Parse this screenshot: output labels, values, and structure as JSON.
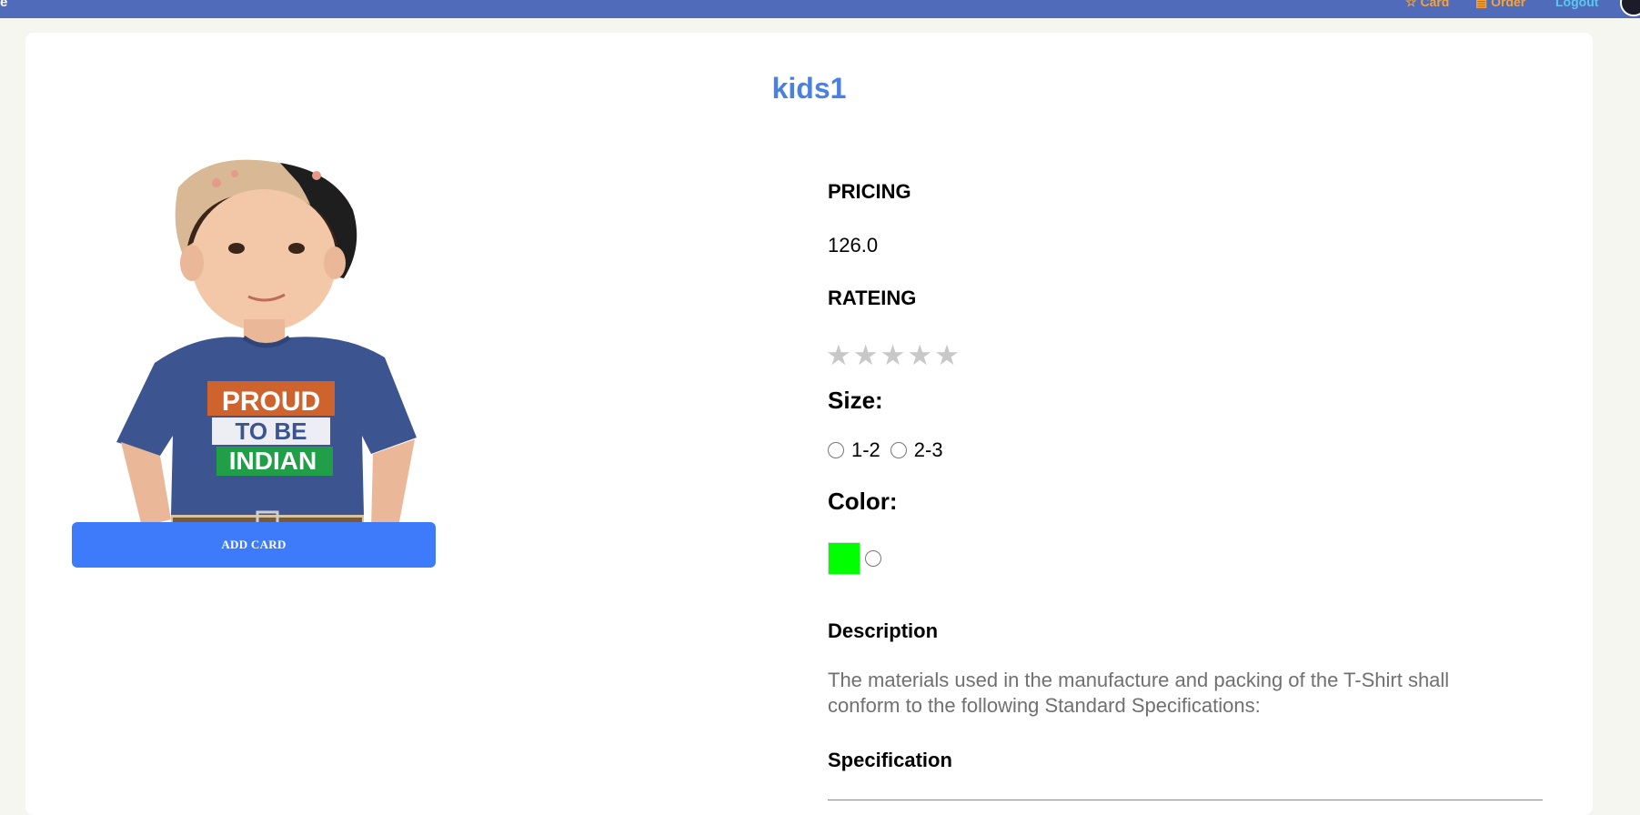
{
  "topbar": {
    "brand_fragment": "e",
    "nav": [
      {
        "label": "☆ Card"
      },
      {
        "label": "▤ Order"
      },
      {
        "label": "Logout"
      }
    ],
    "color": "#4f6bba"
  },
  "product": {
    "title": "kids1",
    "shirt_print": [
      "PROUD",
      "TO BE",
      "INDIAN"
    ],
    "add_button_label": "ADD CARD",
    "pricing_label": "PRICING",
    "price": "126.0",
    "rating_label": "RATEING",
    "rating_stars": "★★★★★",
    "rating_value": 0,
    "rating_max": 5,
    "size_label": "Size:",
    "sizes": [
      "1-2",
      "2-3"
    ],
    "color_label": "Color:",
    "colors": [
      "#00ff00"
    ],
    "description_label": "Description",
    "description_text": "The materials used in the manufacture and packing of the T-Shirt shall conform to the following Standard Specifications:",
    "specification_label": "Specification"
  },
  "colors": {
    "accent": "#3d7bfa",
    "title": "#4a7fe3",
    "swatch": "#00ff00"
  }
}
